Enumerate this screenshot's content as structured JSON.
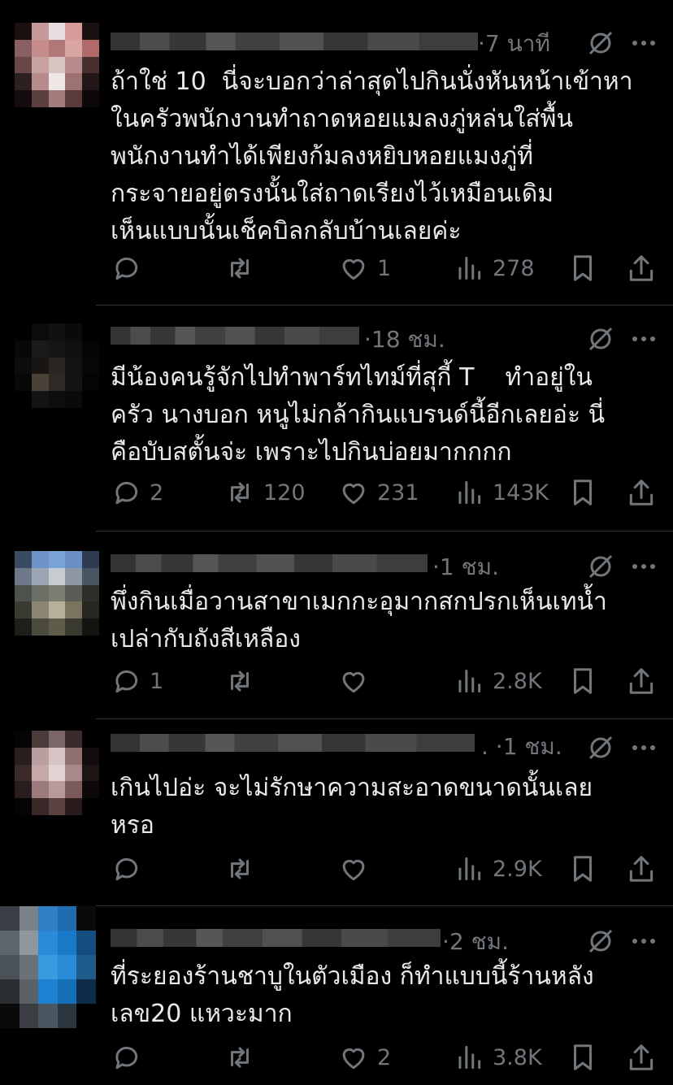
{
  "posts": [
    {
      "time": "·7 นาที",
      "text": "ถ้าใช่ 10  นี่จะบอกว่าล่าสุดไปกินนั่งหันหน้าเข้าหา\nในครัวพนักงานทำถาดหอยแมลงภู่หล่นใส่พื้น\nพนักงานทำได้เพียงก้มลงหยิบหอยแมงภู่ที่\nกระจายอยู่ตรงนั้นใส่ถาดเรียงไว้เหมือนเดิม\nเห็นแบบนั้นเช็คบิลกลับบ้านเลยค่ะ",
      "replies": "",
      "reposts": "",
      "likes": "1",
      "views": "278"
    },
    {
      "time": "·18 ชม.",
      "text": "มีน้องคนรู้จักไปทำพาร์ทไทม์ที่สุกี้ T    ทำอยู่ใน\nครัว นางบอก หนูไม่กล้ากินแบรนด์นี้อีกเลยอ่ะ นี่\nคือบับสตั้นจ่ะ เพราะไปกินบ่อยมากกกก",
      "replies": "2",
      "reposts": "120",
      "likes": "231",
      "views": "143K"
    },
    {
      "time": "·1 ชม.",
      "text": "พึ่งกินเมื่อวานสาขาเมกกะอุมากสกปรกเห็นเทน้ำ\nเปล่ากับถังสีเหลือง",
      "replies": "1",
      "reposts": "",
      "likes": "",
      "views": "2.8K"
    },
    {
      "time": ". ·1 ชม.",
      "text": "เกินไปอ่ะ จะไม่รักษาความสะอาดขนาดนั้นเลย\nหรอ",
      "replies": "",
      "reposts": "",
      "likes": "",
      "views": "2.9K"
    },
    {
      "time": "·2 ชม.",
      "text": "ที่ระยองร้านชาบูในตัวเมือง ก็ทำแบบนี้ร้านหลัง\nเลข20 แหวะมาก",
      "replies": "",
      "reposts": "",
      "likes": "2",
      "views": "3.8K"
    }
  ],
  "icons": {
    "reply": "reply-icon",
    "repost": "repost-icon",
    "like": "like-icon",
    "views": "views-icon",
    "bookmark": "bookmark-icon",
    "share": "share-icon",
    "grok": "grok-icon",
    "more": "more-icon"
  },
  "colors": {
    "background": "#000000",
    "text": "#e7e9ea",
    "muted": "#71767b",
    "divider": "#2f3336"
  }
}
